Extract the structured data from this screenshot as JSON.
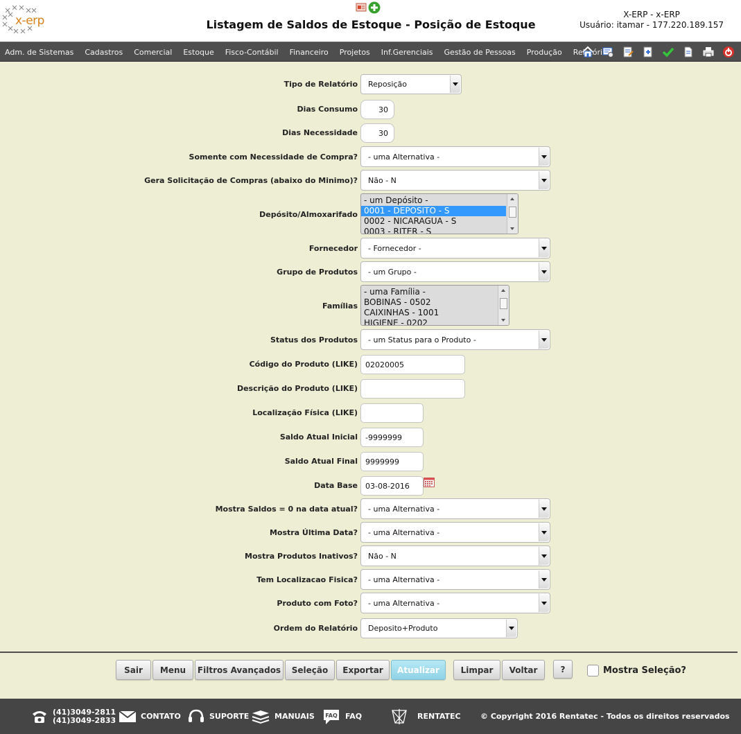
{
  "header": {
    "logo_text": "x-erp",
    "title": "Listagem de Saldos de Estoque - Posição de Estoque",
    "system": "X-ERP - x-ERP",
    "user": "Usuário: itamar - 177.220.189.157"
  },
  "menu": {
    "items": [
      "Adm. de Sistemas",
      "Cadastros",
      "Comercial",
      "Estoque",
      "Fisco-Contábil",
      "Financeiro",
      "Projetos",
      "Inf.Gerenciais",
      "Gestão de Pessoas",
      "Produção",
      "Relatórios"
    ]
  },
  "toolbar_icons": [
    "home-icon",
    "settings-icon",
    "edit-document-icon",
    "save-icon",
    "confirm-icon",
    "document-icon",
    "print-icon",
    "exit-icon"
  ],
  "form": {
    "tipo_relatorio": {
      "label": "Tipo de Relatório",
      "value": "Reposição"
    },
    "dias_consumo": {
      "label": "Dias Consumo",
      "value": "30"
    },
    "dias_necessidade": {
      "label": "Dias Necessidade",
      "value": "30"
    },
    "somente_necessidade": {
      "label": "Somente com Necessidade de Compra?",
      "value": "- uma Alternativa -"
    },
    "gera_solicitacao": {
      "label": "Gera Solicitação de Compras (abaixo do Minimo)?",
      "value": "Não - N"
    },
    "deposito": {
      "label": "Depósito/Almoxarifado",
      "options": [
        "- um Depósito -",
        "0001 - DEPOSITO - S",
        "0002 - NICARAGUA - S",
        "0003 - RITER - S"
      ],
      "selected_index": 1
    },
    "fornecedor": {
      "label": "Fornecedor",
      "value": "- Fornecedor -"
    },
    "grupo": {
      "label": "Grupo de Produtos",
      "value": "- um Grupo -"
    },
    "familias": {
      "label": "Famílias",
      "options": [
        "- uma Família -",
        "BOBINAS - 0502",
        "CAIXINHAS - 1001",
        "HIGIENE - 0202"
      ]
    },
    "status": {
      "label": "Status dos Produtos",
      "value": "- um Status para o Produto -"
    },
    "codigo": {
      "label": "Código do Produto (LIKE)",
      "value": "02020005"
    },
    "descricao": {
      "label": "Descrição do Produto (LIKE)",
      "value": ""
    },
    "localizacao": {
      "label": "Localização Física (LIKE)",
      "value": ""
    },
    "saldo_inicial": {
      "label": "Saldo Atual Inicial",
      "value": "-9999999"
    },
    "saldo_final": {
      "label": "Saldo Atual Final",
      "value": "9999999"
    },
    "data_base": {
      "label": "Data Base",
      "value": "03-08-2016"
    },
    "mostra_saldos_zero": {
      "label": "Mostra Saldos = 0 na data atual?",
      "value": "- uma Alternativa -"
    },
    "mostra_ultima_data": {
      "label": "Mostra Última Data?",
      "value": "- uma Alternativa -"
    },
    "mostra_inativos": {
      "label": "Mostra Produtos Inativos?",
      "value": "Não - N"
    },
    "tem_localizacao": {
      "label": "Tem Localizacao Fisica?",
      "value": "- uma Alternativa -"
    },
    "produto_foto": {
      "label": "Produto com Foto?",
      "value": "- uma Alternativa -"
    },
    "ordem": {
      "label": "Ordem do Relatório",
      "value": "Deposito+Produto"
    }
  },
  "buttons": {
    "sair": "Sair",
    "menu": "Menu",
    "filtros": "Filtros Avançados",
    "selecao": "Seleção",
    "exportar": "Exportar",
    "atualizar": "Atualizar",
    "limpar": "Limpar",
    "voltar": "Voltar",
    "help": "?",
    "mostra_selecao": "Mostra Seleção?"
  },
  "footer": {
    "phone1": "(41)3049-2811",
    "phone2": "(41)3049-2833",
    "contato": "CONTATO",
    "suporte": "SUPORTE",
    "manuais": "MANUAIS",
    "faq": "FAQ",
    "faq_badge": "FAQ",
    "rentatec": "RENTATEC",
    "copyright": "© Copyright 2016 Rentatec - Todos os direitos reservados"
  },
  "colors": {
    "background": "#eeeed5",
    "menubar": "#4e4e4e",
    "footer": "#454545",
    "primary_button": "#9fdcec",
    "logo": "#d9831c",
    "selection": "#3399ff"
  }
}
